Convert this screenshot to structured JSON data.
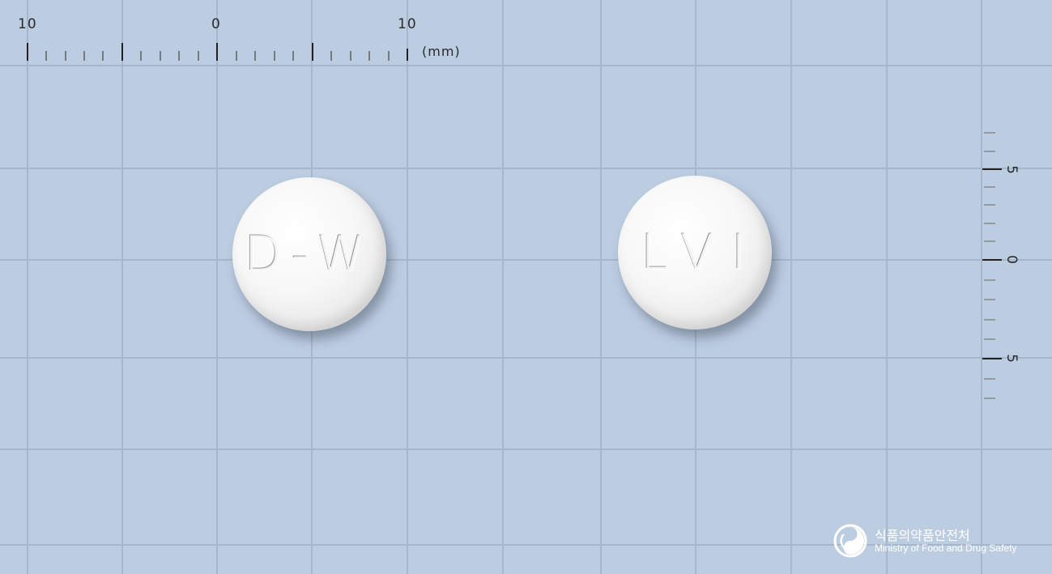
{
  "ruler_top": {
    "labels": [
      "10",
      "0",
      "10"
    ],
    "unit": "(mm)"
  },
  "ruler_right": {
    "labels": [
      "5",
      "0",
      "5"
    ]
  },
  "pills": [
    {
      "imprint": "D-W",
      "color": "#f2f2f2"
    },
    {
      "imprint": "LVI",
      "color": "#f2f2f2"
    }
  ],
  "logo": {
    "name_ko": "식품의약품안전처",
    "name_en": "Ministry of Food and Drug Safety"
  },
  "colors": {
    "background": "#bdcde1",
    "grid": "#a7b7cb",
    "ruler": "#222222",
    "logo": "#ffffff"
  }
}
